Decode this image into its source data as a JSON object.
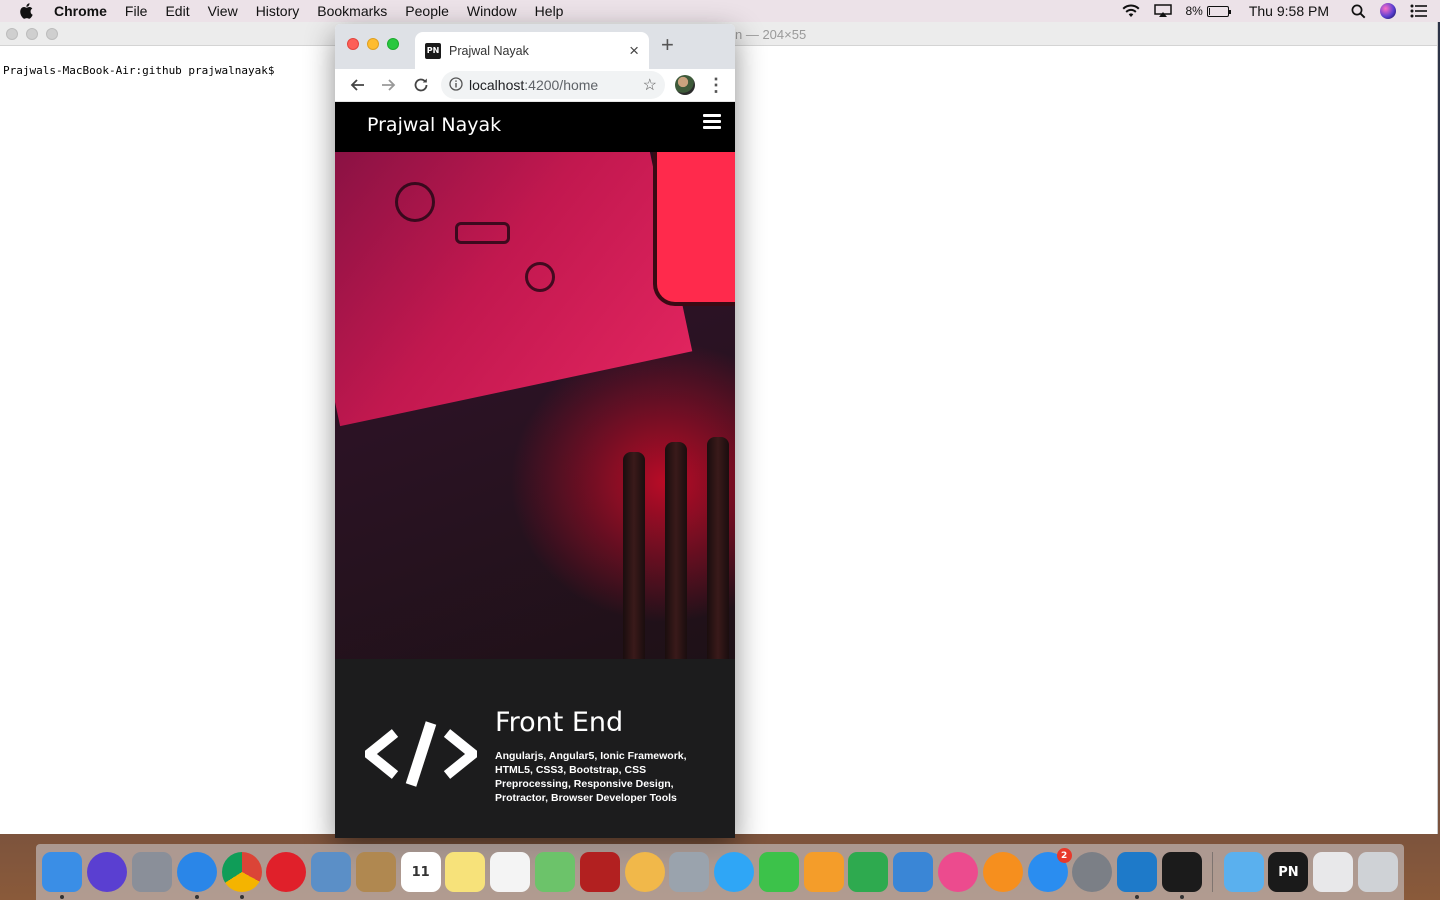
{
  "menubar": {
    "app_name": "Chrome",
    "items": [
      "File",
      "Edit",
      "View",
      "History",
      "Bookmarks",
      "People",
      "Window",
      "Help"
    ],
    "battery_percent": "8%",
    "battery_level": 0.08,
    "clock": "Thu 9:58 PM"
  },
  "terminal": {
    "title": "n — 204×55",
    "prompt": "Prajwals-MacBook-Air:github prajwalnayak$"
  },
  "browser": {
    "tab_title": "Prajwal Nayak",
    "favicon_text": "PN",
    "url_host": "localhost",
    "url_path": ":4200/home"
  },
  "site": {
    "brand": "Prajwal Nayak",
    "skill": {
      "title": "Front End",
      "description": "Angularjs, Angular5, Ionic Framework, HTML5, CSS3, Bootstrap, CSS Preprocessing, Responsive Design, Protractor, Browser Developer Tools"
    }
  },
  "dock": {
    "apps": [
      {
        "name": "finder",
        "color": "#3a8ee6",
        "running": true
      },
      {
        "name": "siri",
        "color": "#5a3fd1",
        "running": false
      },
      {
        "name": "launchpad",
        "color": "#8a8f99",
        "running": false
      },
      {
        "name": "safari",
        "color": "#2a86e8",
        "running": true
      },
      {
        "name": "chrome",
        "color": "#34a853",
        "running": true
      },
      {
        "name": "opera",
        "color": "#e0202a",
        "running": false
      },
      {
        "name": "preview",
        "color": "#5b8fc7",
        "running": false
      },
      {
        "name": "contacts",
        "color": "#b08850",
        "running": false
      },
      {
        "name": "calendar",
        "color": "#ffffff",
        "running": false,
        "label": "11"
      },
      {
        "name": "notes",
        "color": "#f7e27a",
        "running": false
      },
      {
        "name": "reminders",
        "color": "#f4f4f4",
        "running": false
      },
      {
        "name": "maps",
        "color": "#6cc36a",
        "running": false
      },
      {
        "name": "photo-booth",
        "color": "#b22020",
        "running": false
      },
      {
        "name": "photos",
        "color": "#f1b84a",
        "running": false
      },
      {
        "name": "image-capture",
        "color": "#9aa3ad",
        "running": false
      },
      {
        "name": "messages",
        "color": "#2fa6f6",
        "running": false
      },
      {
        "name": "facetime",
        "color": "#3cc24a",
        "running": false
      },
      {
        "name": "pages",
        "color": "#f49d2a",
        "running": false
      },
      {
        "name": "numbers",
        "color": "#2eaa4f",
        "running": false
      },
      {
        "name": "keynote",
        "color": "#3a86d6",
        "running": false
      },
      {
        "name": "itunes",
        "color": "#ec4b8e",
        "running": false
      },
      {
        "name": "ibooks",
        "color": "#f68f1e",
        "running": false
      },
      {
        "name": "app-store",
        "color": "#2a8df0",
        "running": false,
        "badge": "2"
      },
      {
        "name": "system-preferences",
        "color": "#7b7f86",
        "running": false
      },
      {
        "name": "vscode",
        "color": "#1e7ac9",
        "running": true
      },
      {
        "name": "terminal",
        "color": "#1b1b1b",
        "running": true
      },
      {
        "name": "applications-folder",
        "color": "#5ab0ee",
        "running": false
      },
      {
        "name": "pn-stack",
        "color": "#1a1a1a",
        "running": false,
        "label": "PN"
      },
      {
        "name": "downloads-stack",
        "color": "#e8e8ea",
        "running": false
      },
      {
        "name": "trash",
        "color": "#cfd2d6",
        "running": false
      }
    ]
  }
}
